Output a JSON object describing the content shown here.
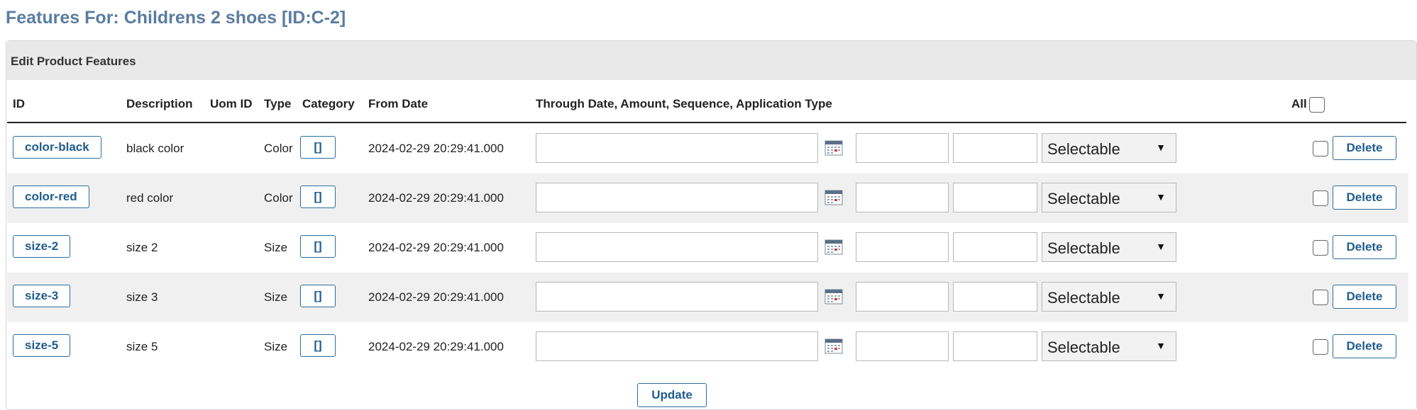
{
  "page": {
    "title": "Features For: Childrens 2 shoes [ID:C-2]"
  },
  "panel": {
    "header": "Edit Product Features"
  },
  "table": {
    "columns": {
      "id": "ID",
      "description": "Description",
      "uom_id": "Uom ID",
      "type": "Type",
      "category": "Category",
      "from_date": "From Date",
      "through": "Through Date, Amount, Sequence, Application Type",
      "all": "All"
    },
    "rows": [
      {
        "id": "color-black",
        "description": "black color",
        "type": "Color",
        "category": "[]",
        "from_date": "2024-02-29 20:29:41.000",
        "application_type": "Selectable",
        "delete": "Delete"
      },
      {
        "id": "color-red",
        "description": "red color",
        "type": "Color",
        "category": "[]",
        "from_date": "2024-02-29 20:29:41.000",
        "application_type": "Selectable",
        "delete": "Delete"
      },
      {
        "id": "size-2",
        "description": "size 2",
        "type": "Size",
        "category": "[]",
        "from_date": "2024-02-29 20:29:41.000",
        "application_type": "Selectable",
        "delete": "Delete"
      },
      {
        "id": "size-3",
        "description": "size 3",
        "type": "Size",
        "category": "[]",
        "from_date": "2024-02-29 20:29:41.000",
        "application_type": "Selectable",
        "delete": "Delete"
      },
      {
        "id": "size-5",
        "description": "size 5",
        "type": "Size",
        "category": "[]",
        "from_date": "2024-02-29 20:29:41.000",
        "application_type": "Selectable",
        "delete": "Delete"
      }
    ]
  },
  "actions": {
    "update": "Update"
  },
  "colors": {
    "title": "#5b7da1",
    "button_text": "#1f5c8f",
    "button_border": "#2d6d9f",
    "header_bg": "#e9e9e9",
    "alt_row_bg": "#f0f0f0"
  }
}
